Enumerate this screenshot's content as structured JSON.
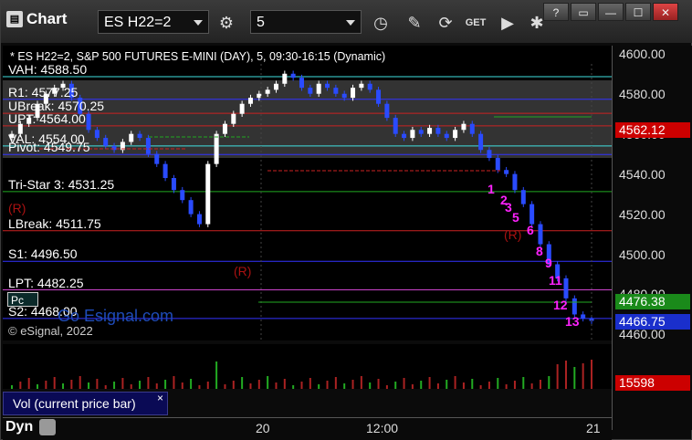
{
  "toolbar": {
    "app_title": "Chart",
    "symbol": "ES H22=2",
    "interval": "5",
    "window_controls": [
      "?",
      "▭",
      "—",
      "☐",
      "✕"
    ]
  },
  "chart": {
    "title": "* ES H22=2, S&P 500 FUTURES E-MINI (DAY), 5, 09:30-16:15 (Dynamic)",
    "watermark": "Go Esignal.com",
    "copyright": "© eSignal, 2022",
    "pivot_button": "Pc",
    "levels": [
      {
        "label": "VAH: 4588.50",
        "value": 4588.5,
        "color": "#40e0e0"
      },
      {
        "label": "R1: 4577.25",
        "value": 4577.25,
        "color": "#3333ff"
      },
      {
        "label": "UBreak: 4570.25",
        "value": 4570.25,
        "color": "#cc2222"
      },
      {
        "label": "UPT: 4564.00",
        "value": 4564.0,
        "color": "#cc2222"
      },
      {
        "label": "VAL: 4554.00",
        "value": 4554.0,
        "color": "#40e0e0"
      },
      {
        "label": "Pivot: 4549.75",
        "value": 4549.75,
        "color": "#3333ff"
      },
      {
        "label": "Tri-Star 3: 4531.25",
        "value": 4531.25,
        "color": "#22aa22"
      },
      {
        "label": "LBreak: 4511.75",
        "value": 4511.75,
        "color": "#cc2222"
      },
      {
        "label": "S1: 4496.50",
        "value": 4496.5,
        "color": "#3333ff"
      },
      {
        "label": "LPT: 4482.25",
        "value": 4482.25,
        "color": "#cc44cc"
      },
      {
        "label": "S2: 4468.00",
        "value": 4468.0,
        "color": "#3333ff"
      }
    ],
    "annotations": {
      "r_markers": [
        "(R)",
        "(R)",
        "(R)"
      ],
      "count_labels": [
        "1",
        "2",
        "3",
        "5",
        "6",
        "8",
        "9",
        "11",
        "12",
        "13"
      ]
    }
  },
  "price_axis": {
    "ticks": [
      "4600.00",
      "4580.00",
      "4560.00",
      "4540.00",
      "4520.00",
      "4500.00",
      "4480.00",
      "4460.00"
    ],
    "tags": [
      {
        "label": "4562.12",
        "value": 4562.12,
        "color": "#cc0000"
      },
      {
        "label": "4476.38",
        "value": 4476.38,
        "color": "#1a8a1a"
      },
      {
        "label": "4466.75",
        "value": 4466.75,
        "color": "#1a2fcc"
      }
    ]
  },
  "volume": {
    "title": "Vol (current price bar)",
    "close_label": "×",
    "last_value": "15598"
  },
  "time_axis": {
    "ticks": [
      "20",
      "12:00",
      "21"
    ]
  },
  "footer": {
    "mode": "Dyn"
  },
  "chart_data": {
    "type": "candlestick",
    "title": "* ES H22=2, S&P 500 FUTURES E-MINI (DAY), 5, 09:30-16:15 (Dynamic)",
    "ylim": [
      4457,
      4604
    ],
    "x_ticks": [
      "20",
      "12:00",
      "21"
    ],
    "approx_closes": [
      4560,
      4565,
      4568,
      4575,
      4580,
      4583,
      4585,
      4578,
      4570,
      4562,
      4558,
      4554,
      4552,
      4556,
      4560,
      4558,
      4550,
      4545,
      4538,
      4532,
      4527,
      4520,
      4515,
      4545,
      4560,
      4565,
      4570,
      4575,
      4578,
      4580,
      4582,
      4585,
      4590,
      4588,
      4583,
      4580,
      4585,
      4583,
      4580,
      4578,
      4583,
      4585,
      4582,
      4575,
      4568,
      4560,
      4558,
      4562,
      4560,
      4563,
      4560,
      4558,
      4562,
      4565,
      4560,
      4552,
      4548,
      4542,
      4540,
      4532,
      4525,
      4515,
      4505,
      4495,
      4488,
      4478,
      4470,
      4468,
      4466.75
    ],
    "volume_last": 15598
  }
}
